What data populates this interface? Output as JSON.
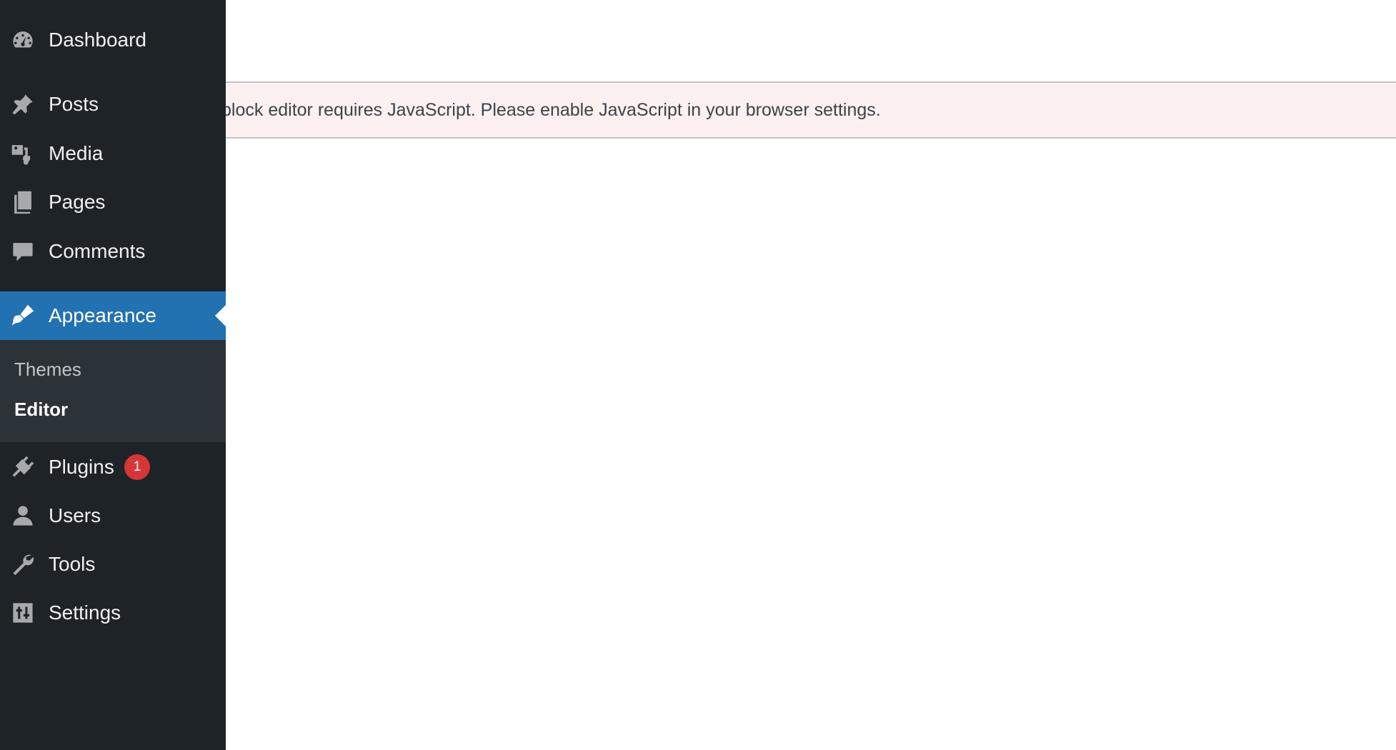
{
  "sidebar": {
    "items": [
      {
        "label": "Dashboard",
        "icon": "dashboard-icon"
      },
      {
        "label": "Posts",
        "icon": "pin-icon"
      },
      {
        "label": "Media",
        "icon": "media-icon"
      },
      {
        "label": "Pages",
        "icon": "pages-icon"
      },
      {
        "label": "Comments",
        "icon": "comment-icon"
      },
      {
        "label": "Appearance",
        "icon": "brush-icon",
        "active": true
      },
      {
        "label": "Plugins",
        "icon": "plugin-icon",
        "badge": "1"
      },
      {
        "label": "Users",
        "icon": "user-icon"
      },
      {
        "label": "Tools",
        "icon": "wrench-icon"
      },
      {
        "label": "Settings",
        "icon": "settings-icon"
      }
    ],
    "submenu": [
      {
        "label": "Themes"
      },
      {
        "label": "Editor",
        "current": true
      }
    ]
  },
  "notice": {
    "text": "The block editor requires JavaScript. Please enable JavaScript in your browser settings."
  },
  "colors": {
    "sidebar_bg": "#1d2327",
    "submenu_bg": "#2c3338",
    "active_bg": "#2271b1",
    "badge_bg": "#d63638",
    "notice_bg": "#fcf0f1"
  }
}
